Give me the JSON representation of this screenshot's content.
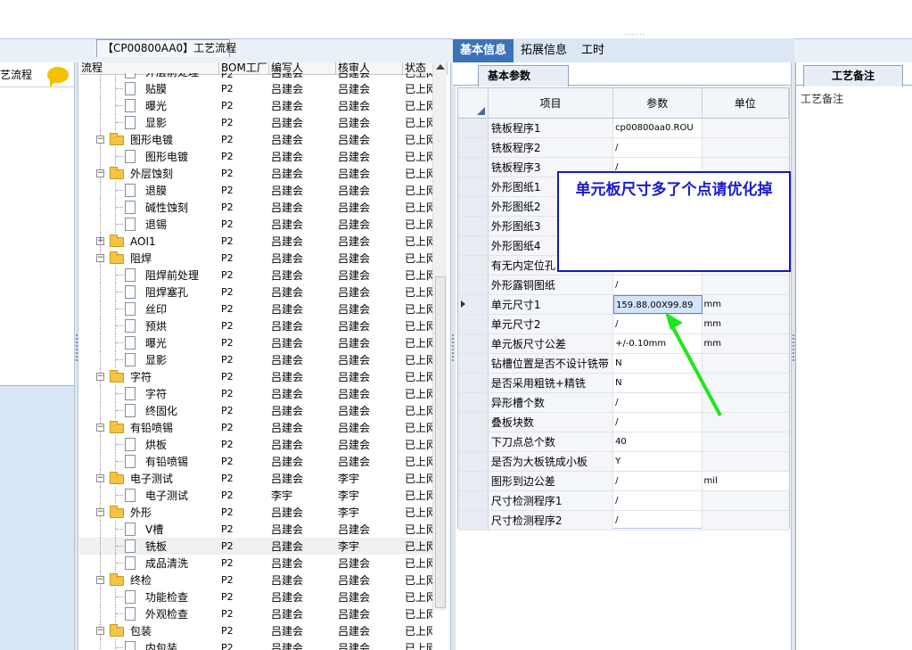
{
  "header": {
    "grip": "········"
  },
  "left_panel": {
    "title": "艺流程"
  },
  "process_tab": {
    "title": "【CP00800AA0】工艺流程"
  },
  "tree_columns": [
    "流程",
    "BOM工厂",
    "编写人",
    "核审人",
    "状态"
  ],
  "tree_rows": [
    {
      "label": "外层前处理",
      "depth": 2,
      "type": "doc",
      "bom": "P2",
      "writer": "吕建会",
      "reviewer": "吕建会",
      "status": "已上网",
      "partial": true
    },
    {
      "label": "贴膜",
      "depth": 2,
      "type": "doc",
      "bom": "P2",
      "writer": "吕建会",
      "reviewer": "吕建会",
      "status": "已上网"
    },
    {
      "label": "曝光",
      "depth": 2,
      "type": "doc",
      "bom": "P2",
      "writer": "吕建会",
      "reviewer": "吕建会",
      "status": "已上网"
    },
    {
      "label": "显影",
      "depth": 2,
      "type": "doc",
      "bom": "P2",
      "writer": "吕建会",
      "reviewer": "吕建会",
      "status": "已上网"
    },
    {
      "label": "图形电镀",
      "depth": 1,
      "type": "folder",
      "bom": "P2",
      "writer": "吕建会",
      "reviewer": "吕建会",
      "status": "已上网"
    },
    {
      "label": "图形电镀",
      "depth": 2,
      "type": "doc",
      "bom": "P2",
      "writer": "吕建会",
      "reviewer": "吕建会",
      "status": "已上网"
    },
    {
      "label": "外层蚀刻",
      "depth": 1,
      "type": "folder",
      "bom": "P2",
      "writer": "吕建会",
      "reviewer": "吕建会",
      "status": "已上网"
    },
    {
      "label": "退膜",
      "depth": 2,
      "type": "doc",
      "bom": "P2",
      "writer": "吕建会",
      "reviewer": "吕建会",
      "status": "已上网"
    },
    {
      "label": "碱性蚀刻",
      "depth": 2,
      "type": "doc",
      "bom": "P2",
      "writer": "吕建会",
      "reviewer": "吕建会",
      "status": "已上网"
    },
    {
      "label": "退锡",
      "depth": 2,
      "type": "doc",
      "bom": "P2",
      "writer": "吕建会",
      "reviewer": "吕建会",
      "status": "已上网"
    },
    {
      "label": "AOI1",
      "depth": 1,
      "type": "folder",
      "collapsed": true,
      "bom": "P2",
      "writer": "吕建会",
      "reviewer": "吕建会",
      "status": "已上网"
    },
    {
      "label": "阻焊",
      "depth": 1,
      "type": "folder",
      "bom": "P2",
      "writer": "吕建会",
      "reviewer": "吕建会",
      "status": "已上网"
    },
    {
      "label": "阻焊前处理",
      "depth": 2,
      "type": "doc",
      "bom": "P2",
      "writer": "吕建会",
      "reviewer": "吕建会",
      "status": "已上网"
    },
    {
      "label": "阻焊塞孔",
      "depth": 2,
      "type": "doc",
      "bom": "P2",
      "writer": "吕建会",
      "reviewer": "吕建会",
      "status": "已上网"
    },
    {
      "label": "丝印",
      "depth": 2,
      "type": "doc",
      "bom": "P2",
      "writer": "吕建会",
      "reviewer": "吕建会",
      "status": "已上网"
    },
    {
      "label": "预烘",
      "depth": 2,
      "type": "doc",
      "bom": "P2",
      "writer": "吕建会",
      "reviewer": "吕建会",
      "status": "已上网"
    },
    {
      "label": "曝光",
      "depth": 2,
      "type": "doc",
      "bom": "P2",
      "writer": "吕建会",
      "reviewer": "吕建会",
      "status": "已上网"
    },
    {
      "label": "显影",
      "depth": 2,
      "type": "doc",
      "bom": "P2",
      "writer": "吕建会",
      "reviewer": "吕建会",
      "status": "已上网"
    },
    {
      "label": "字符",
      "depth": 1,
      "type": "folder",
      "bom": "P2",
      "writer": "吕建会",
      "reviewer": "吕建会",
      "status": "已上网"
    },
    {
      "label": "字符",
      "depth": 2,
      "type": "doc",
      "bom": "P2",
      "writer": "吕建会",
      "reviewer": "吕建会",
      "status": "已上网"
    },
    {
      "label": "终固化",
      "depth": 2,
      "type": "doc",
      "bom": "P2",
      "writer": "吕建会",
      "reviewer": "吕建会",
      "status": "已上网"
    },
    {
      "label": "有铅喷锡",
      "depth": 1,
      "type": "folder",
      "bom": "P2",
      "writer": "吕建会",
      "reviewer": "吕建会",
      "status": "已上网"
    },
    {
      "label": "烘板",
      "depth": 2,
      "type": "doc",
      "bom": "P2",
      "writer": "吕建会",
      "reviewer": "吕建会",
      "status": "已上网"
    },
    {
      "label": "有铅喷锡",
      "depth": 2,
      "type": "doc",
      "bom": "P2",
      "writer": "吕建会",
      "reviewer": "吕建会",
      "status": "已上网"
    },
    {
      "label": "电子测试",
      "depth": 1,
      "type": "folder",
      "bom": "P2",
      "writer": "吕建会",
      "reviewer": "李宇",
      "status": "已上网"
    },
    {
      "label": "电子测试",
      "depth": 2,
      "type": "doc",
      "bom": "P2",
      "writer": "李宇",
      "reviewer": "李宇",
      "status": "已上网"
    },
    {
      "label": "外形",
      "depth": 1,
      "type": "folder",
      "bom": "P2",
      "writer": "吕建会",
      "reviewer": "李宇",
      "status": "已上网"
    },
    {
      "label": "V槽",
      "depth": 2,
      "type": "doc",
      "bom": "P2",
      "writer": "吕建会",
      "reviewer": "吕建会",
      "status": "已上网"
    },
    {
      "label": "铣板",
      "depth": 2,
      "type": "doc",
      "bom": "P2",
      "writer": "吕建会",
      "reviewer": "李宇",
      "status": "已上网",
      "selected": true
    },
    {
      "label": "成品清洗",
      "depth": 2,
      "type": "doc",
      "bom": "P2",
      "writer": "吕建会",
      "reviewer": "吕建会",
      "status": "已上网"
    },
    {
      "label": "终检",
      "depth": 1,
      "type": "folder",
      "bom": "P2",
      "writer": "吕建会",
      "reviewer": "吕建会",
      "status": "已上网"
    },
    {
      "label": "功能检查",
      "depth": 2,
      "type": "doc",
      "bom": "P2",
      "writer": "吕建会",
      "reviewer": "吕建会",
      "status": "已上网"
    },
    {
      "label": "外观检查",
      "depth": 2,
      "type": "doc",
      "bom": "P2",
      "writer": "吕建会",
      "reviewer": "吕建会",
      "status": "已上网"
    },
    {
      "label": "包装",
      "depth": 1,
      "type": "folder",
      "bom": "P2",
      "writer": "吕建会",
      "reviewer": "吕建会",
      "status": "已上网"
    },
    {
      "label": "内包装",
      "depth": 2,
      "type": "doc",
      "bom": "P2",
      "writer": "吕建会",
      "reviewer": "吕建会",
      "status": "已上网",
      "partial": true
    }
  ],
  "right_tabs": [
    "基本信息",
    "拓展信息",
    "工时"
  ],
  "basic_params": {
    "subtab": "基本参数",
    "columns": [
      "项目",
      "参数",
      "单位"
    ],
    "rows": [
      {
        "name": "铣板程序1",
        "value": "cp00800aa0.ROU",
        "unit": ""
      },
      {
        "name": "铣板程序2",
        "value": "/",
        "unit": ""
      },
      {
        "name": "铣板程序3",
        "value": "/",
        "unit": ""
      },
      {
        "name": "外形图纸1",
        "value": "",
        "unit": ""
      },
      {
        "name": "外形图纸2",
        "value": "",
        "unit": ""
      },
      {
        "name": "外形图纸3",
        "value": "",
        "unit": ""
      },
      {
        "name": "外形图纸4",
        "value": "",
        "unit": ""
      },
      {
        "name": "有无内定位孔",
        "value": "",
        "unit": ""
      },
      {
        "name": "外形露铜图纸",
        "value": "/",
        "unit": ""
      },
      {
        "name": "单元尺寸1",
        "value": "159.88.00X99.89",
        "unit": "mm",
        "current": true
      },
      {
        "name": "单元尺寸2",
        "value": "/",
        "unit": "mm"
      },
      {
        "name": "单元板尺寸公差",
        "value": "+/-0.10mm",
        "unit": "mm"
      },
      {
        "name": "钻槽位置是否不设计铣带",
        "value": "N",
        "unit": ""
      },
      {
        "name": "是否采用粗铣+精铣",
        "value": "N",
        "unit": ""
      },
      {
        "name": "异形槽个数",
        "value": "/",
        "unit": ""
      },
      {
        "name": "叠板块数",
        "value": "/",
        "unit": ""
      },
      {
        "name": "下刀点总个数",
        "value": "40",
        "unit": ""
      },
      {
        "name": "是否为大板铣成小板",
        "value": "Y",
        "unit": ""
      },
      {
        "name": "图形到边公差",
        "value": "/",
        "unit": "mil"
      },
      {
        "name": "尺寸检测程序1",
        "value": "/",
        "unit": ""
      },
      {
        "name": "尺寸检测程序2",
        "value": "/",
        "unit": ""
      }
    ]
  },
  "callout": {
    "text": "单元板尺寸多了个点请优化掉",
    "color": "#1a1ad0"
  },
  "notes_panel": {
    "tab": "工艺备注",
    "label": "工艺备注"
  },
  "colors": {
    "active_tab": "#3b73b9",
    "arrow": "#1de81d",
    "folder": "#f5c542"
  }
}
